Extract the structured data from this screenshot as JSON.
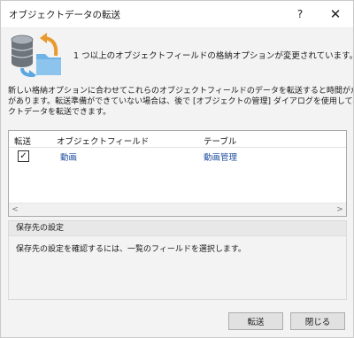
{
  "window": {
    "title": "オブジェクトデータの転送",
    "help_label": "?",
    "close_label": "✕"
  },
  "header": {
    "icon": "database-folder-transfer-icon",
    "message": "1 つ以上のオブジェクトフィールドの格納オプションが変更されています。"
  },
  "description": {
    "lines": [
      "新しい格納オプションに合わせてこれらのオブジェクトフィールドのデータを転送すると時間がかかる場合",
      "があります。転送準備ができていない場合は、後で [オブジェクトの管理] ダイアログを使用して、オブジェ",
      "クトデータを転送できます。"
    ]
  },
  "table": {
    "columns": [
      "転送",
      "オブジェクトフィールド",
      "テーブル"
    ],
    "rows": [
      {
        "checked": true,
        "check_mark": "✓",
        "field": "動画",
        "table": "動画管理"
      }
    ],
    "scroll_left": "<",
    "scroll_right": ">"
  },
  "storage": {
    "title": "保存先の設定",
    "message": "保存先の設定を確認するには、一覧のフィールドを選択します。"
  },
  "buttons": {
    "transfer": "転送",
    "close": "閉じる"
  },
  "colors": {
    "link_text": "#1f4e9e",
    "window_bg": "#f3f3f3",
    "button_bg": "#e1e1e1"
  }
}
